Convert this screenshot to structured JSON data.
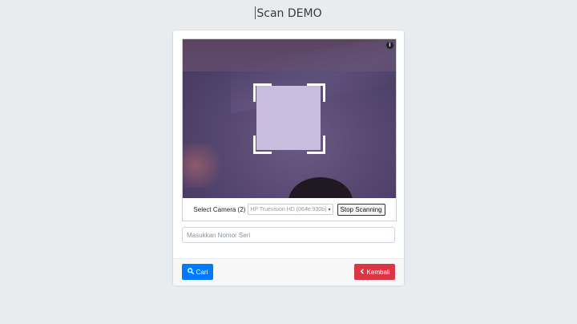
{
  "header": {
    "title": "Scan DEMO"
  },
  "scanner": {
    "camera_label": "Select Camera (2)",
    "camera_selected": "HP Truevision HD (064e:930b)",
    "stop_label": "Stop Scanning",
    "info_glyph": "i"
  },
  "form": {
    "serial_placeholder": "Masukkan Nomor Seri"
  },
  "footer": {
    "search_label": "Cari",
    "back_label": "Kembali"
  },
  "colors": {
    "primary": "#007bff",
    "danger": "#dc3545",
    "background": "#e9ecef"
  },
  "icons": {
    "search": "search-icon",
    "back": "chevron-left-icon",
    "info": "info-icon"
  }
}
